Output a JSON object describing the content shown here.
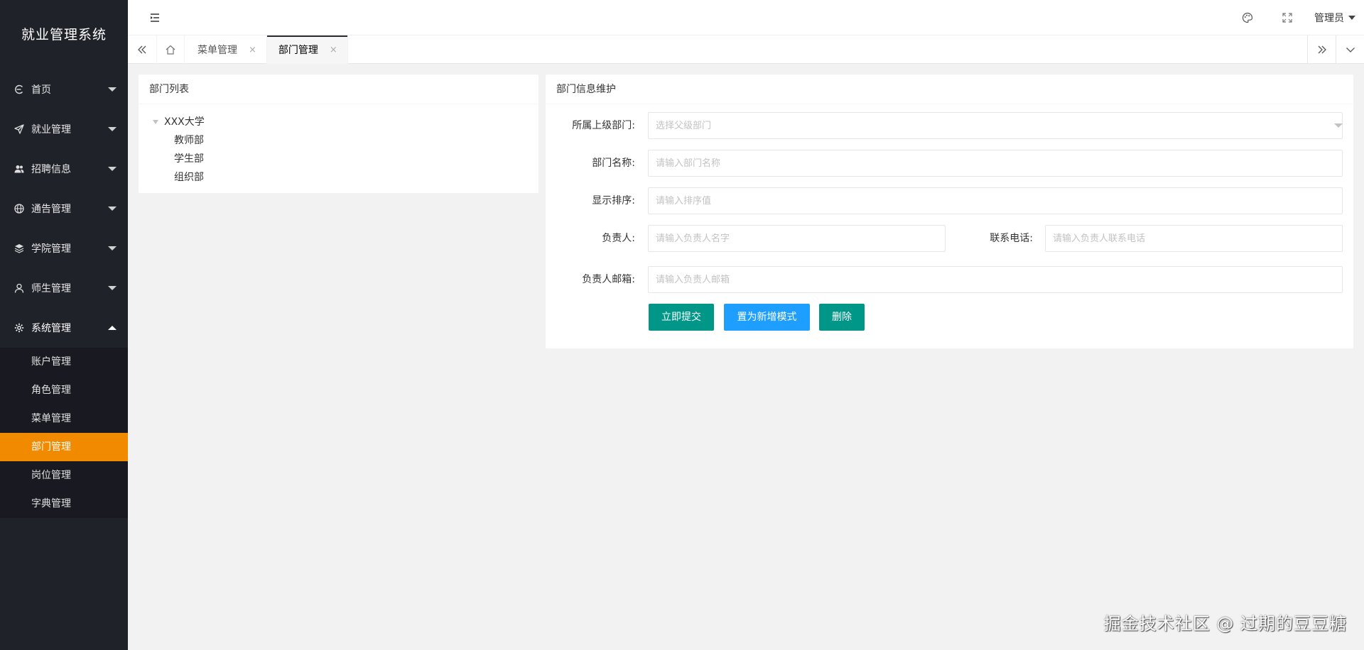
{
  "app": {
    "title": "就业管理系统"
  },
  "sidebar": {
    "items": [
      {
        "label": "首页",
        "icon": "home-icon"
      },
      {
        "label": "就业管理",
        "icon": "send-icon"
      },
      {
        "label": "招聘信息",
        "icon": "users-icon"
      },
      {
        "label": "通告管理",
        "icon": "globe-icon"
      },
      {
        "label": "学院管理",
        "icon": "layers-icon"
      },
      {
        "label": "师生管理",
        "icon": "user-icon"
      },
      {
        "label": "系统管理",
        "icon": "gear-icon"
      }
    ],
    "system_submenu": [
      {
        "label": "账户管理"
      },
      {
        "label": "角色管理"
      },
      {
        "label": "菜单管理"
      },
      {
        "label": "部门管理",
        "active": true
      },
      {
        "label": "岗位管理"
      },
      {
        "label": "字典管理"
      }
    ]
  },
  "header": {
    "user": "管理员"
  },
  "tabs": [
    {
      "label": "菜单管理",
      "close": "×"
    },
    {
      "label": "部门管理",
      "close": "×",
      "active": true
    }
  ],
  "dept_list": {
    "title": "部门列表",
    "root": "XXX大学",
    "children": [
      "教师部",
      "学生部",
      "组织部"
    ]
  },
  "dept_form": {
    "title": "部门信息维护",
    "parent_label": "所属上级部门:",
    "parent_placeholder": "选择父级部门",
    "name_label": "部门名称:",
    "name_placeholder": "请输入部门名称",
    "order_label": "显示排序:",
    "order_placeholder": "请输入排序值",
    "leader_label": "负责人:",
    "leader_placeholder": "请输入负责人名字",
    "phone_label": "联系电话:",
    "phone_placeholder": "请输入负责人联系电话",
    "email_label": "负责人邮箱:",
    "email_placeholder": "请输入负责人邮箱",
    "submit": "立即提交",
    "new_mode": "置为新增模式",
    "delete": "删除"
  },
  "watermark": "掘金技术社区 @ 过期的豆豆糖",
  "colors": {
    "sidebar_bg": "#20222a",
    "active_orange": "#f28a00",
    "primary_green": "#009688",
    "normal_blue": "#1e9fff"
  }
}
